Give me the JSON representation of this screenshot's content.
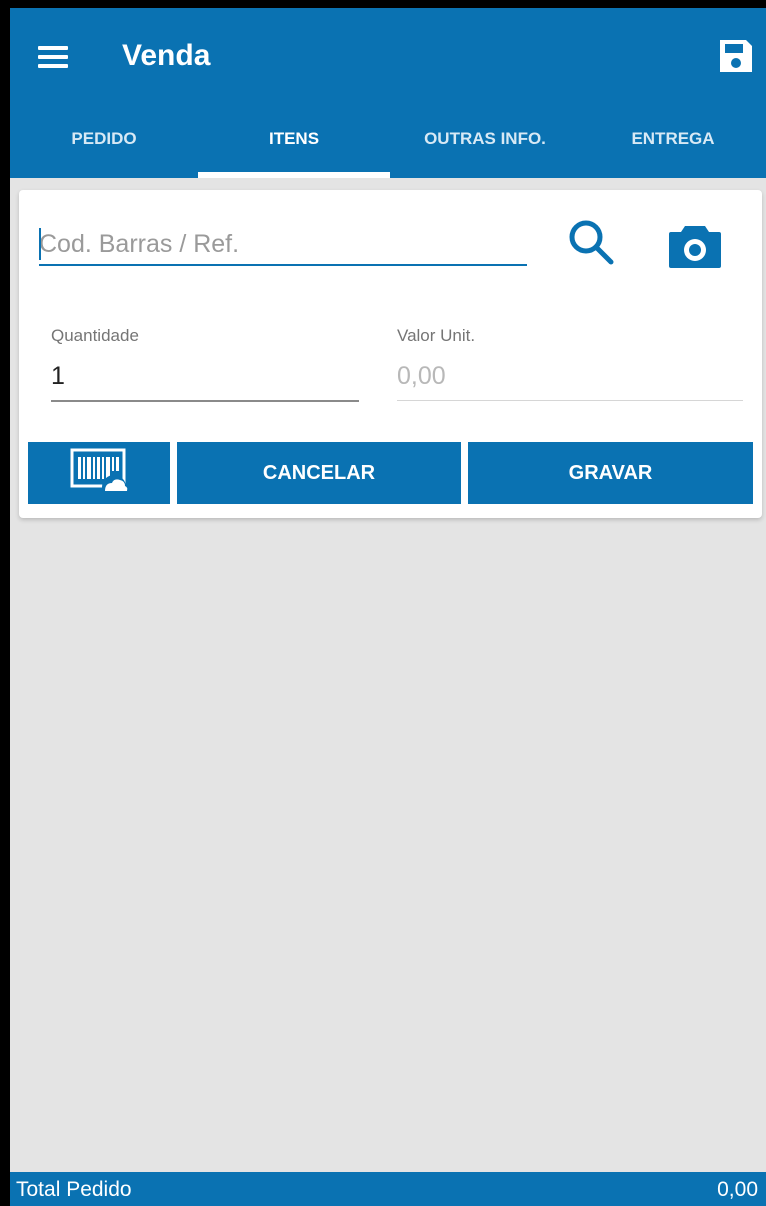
{
  "appbar": {
    "title": "Venda",
    "menu_icon": "hamburger-menu-icon",
    "save_icon": "floppy-disk-save-icon"
  },
  "tabs": [
    {
      "label": "PEDIDO",
      "active": false
    },
    {
      "label": "ITENS",
      "active": true
    },
    {
      "label": "OUTRAS INFO.",
      "active": false
    },
    {
      "label": "ENTREGA",
      "active": false
    }
  ],
  "search": {
    "placeholder": "Cod. Barras / Ref.",
    "value": "",
    "search_icon": "magnifier-search-icon",
    "camera_icon": "camera-icon"
  },
  "quantity": {
    "label": "Quantidade",
    "value": "1"
  },
  "unit_price": {
    "label": "Valor Unit.",
    "placeholder": "0,00"
  },
  "buttons": {
    "barcode_cloud_icon": "barcode-cloud-icon",
    "cancel": "CANCELAR",
    "save": "GRAVAR"
  },
  "footer": {
    "label": "Total Pedido",
    "value": "0,00"
  },
  "colors": {
    "primary": "#0a72b2",
    "background": "#e4e4e4"
  }
}
